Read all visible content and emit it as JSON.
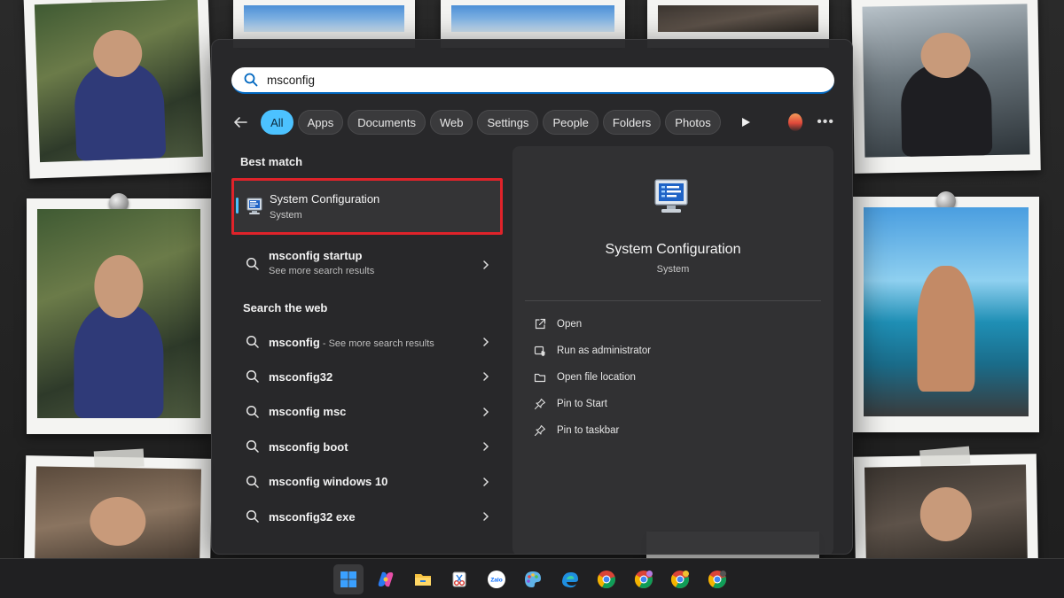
{
  "search": {
    "value": "msconfig"
  },
  "filters": {
    "items": [
      "All",
      "Apps",
      "Documents",
      "Web",
      "Settings",
      "People",
      "Folders",
      "Photos"
    ],
    "active": "All"
  },
  "best_match": {
    "heading": "Best match",
    "title": "System Configuration",
    "subtitle": "System"
  },
  "startup_result": {
    "title": "msconfig startup",
    "subtitle": "See more search results"
  },
  "web": {
    "heading": "Search the web",
    "items": [
      {
        "text": "msconfig",
        "suffix": " - See more search results"
      },
      {
        "text": "msconfig32",
        "suffix": ""
      },
      {
        "text": "msconfig msc",
        "suffix": ""
      },
      {
        "text": "msconfig boot",
        "suffix": ""
      },
      {
        "text": "msconfig windows 10",
        "suffix": ""
      },
      {
        "text": "msconfig32 exe",
        "suffix": ""
      }
    ]
  },
  "detail": {
    "title": "System Configuration",
    "subtitle": "System",
    "actions": [
      {
        "label": "Open",
        "icon": "open-external-icon"
      },
      {
        "label": "Run as administrator",
        "icon": "shield-admin-icon"
      },
      {
        "label": "Open file location",
        "icon": "folder-icon"
      },
      {
        "label": "Pin to Start",
        "icon": "pin-icon"
      },
      {
        "label": "Pin to taskbar",
        "icon": "pin-icon"
      }
    ]
  },
  "taskbar": {
    "apps": [
      "windows-start-icon",
      "copilot-icon",
      "file-explorer-icon",
      "snipping-tool-icon",
      "zalo-icon",
      "paint-icon",
      "edge-icon",
      "chrome-icon",
      "chrome-profile-1-icon",
      "chrome-profile-2-icon",
      "chrome-profile-3-icon"
    ],
    "zalo_label": "Zalo"
  },
  "colors": {
    "accent": "#4cc2ff",
    "highlight_border": "#e0232a",
    "panel_bg": "#28282a"
  }
}
